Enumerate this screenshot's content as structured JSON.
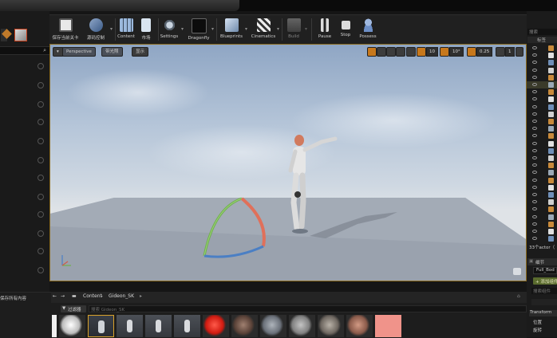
{
  "toolbar": {
    "buttons": [
      {
        "label": "保存当前关卡",
        "icon": "save-icon"
      },
      {
        "label": "源码控制",
        "icon": "source-control-icon"
      },
      {
        "label": "Content",
        "icon": "content-icon"
      },
      {
        "label": "市场",
        "icon": "marketplace-icon"
      },
      {
        "label": "Settings",
        "icon": "settings-icon"
      },
      {
        "label": "Dragonfly",
        "icon": "dragonfly-icon"
      },
      {
        "label": "Blueprints",
        "icon": "blueprints-icon"
      },
      {
        "label": "Cinematics",
        "icon": "cinematics-icon"
      },
      {
        "label": "Build",
        "icon": "build-icon"
      },
      {
        "label": "Pause",
        "icon": "pause-icon"
      },
      {
        "label": "Stop",
        "icon": "stop-icon"
      },
      {
        "label": "Possess",
        "icon": "possess-icon"
      }
    ]
  },
  "viewport": {
    "view_mode": "Perspective",
    "lighting": "带光照",
    "show": "显示",
    "grid_snap": "10",
    "rot_snap": "10°",
    "scale_snap": "0.25",
    "camera_speed": "1"
  },
  "content_browser": {
    "save_all": "保存所有内容",
    "path": [
      "Content",
      "Gideon_SK"
    ],
    "filter_label": "过滤器",
    "search_placeholder": "搜索 Gideon_SK"
  },
  "right_panel": {
    "search_placeholder": "搜索",
    "label_header": "标签",
    "selected_actor": "33个actor（",
    "details_title": "细节",
    "details_item": "Full_Bod",
    "add_component": "+ 添加组件",
    "search_components": "搜索组件",
    "transform": "Transform",
    "location": "位置",
    "rotation": "旋转"
  },
  "colors": {
    "accent": "#c7781c",
    "highlight": "#8a6a1e"
  }
}
